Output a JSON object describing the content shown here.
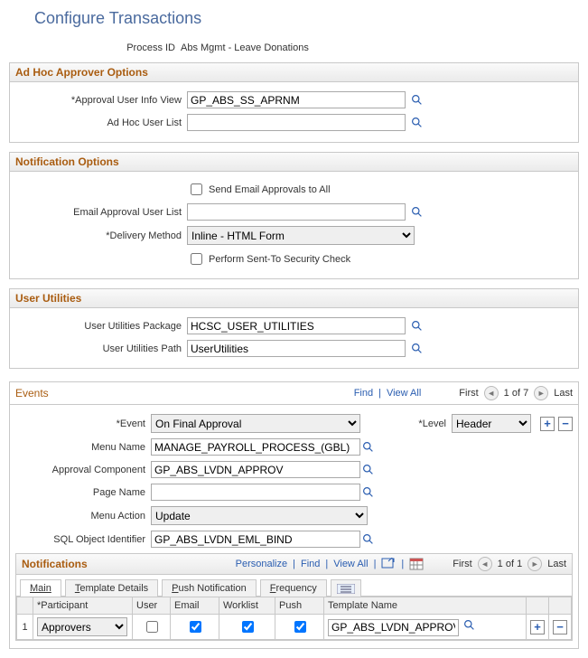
{
  "pageTitle": "Configure Transactions",
  "processId": {
    "label": "Process ID",
    "value": "Abs Mgmt - Leave Donations"
  },
  "adHoc": {
    "header": "Ad Hoc Approver Options",
    "approvalUserInfoView": {
      "label": "*Approval User Info View",
      "value": "GP_ABS_SS_APRNM"
    },
    "adHocUserList": {
      "label": "Ad Hoc User List",
      "value": ""
    }
  },
  "notificationOptions": {
    "header": "Notification Options",
    "sendEmailAll": {
      "label": "Send Email Approvals to All",
      "checked": false
    },
    "emailUserList": {
      "label": "Email Approval User List",
      "value": ""
    },
    "deliveryMethod": {
      "label": "*Delivery Method",
      "value": "Inline - HTML Form"
    },
    "performSentTo": {
      "label": "Perform Sent-To Security Check",
      "checked": false
    }
  },
  "userUtilities": {
    "header": "User Utilities",
    "package": {
      "label": "User Utilities Package",
      "value": "HCSC_USER_UTILITIES"
    },
    "path": {
      "label": "User Utilities Path",
      "value": "UserUtilities"
    }
  },
  "events": {
    "title": "Events",
    "findLabel": "Find",
    "viewAllLabel": "View All",
    "firstLabel": "First",
    "lastLabel": "Last",
    "counter": "1 of 7",
    "event": {
      "label": "*Event",
      "value": "On Final Approval"
    },
    "level": {
      "label": "*Level",
      "value": "Header"
    },
    "menuName": {
      "label": "Menu Name",
      "value": "MANAGE_PAYROLL_PROCESS_(GBL)"
    },
    "approvalComponent": {
      "label": "Approval Component",
      "value": "GP_ABS_LVDN_APPROV"
    },
    "pageName": {
      "label": "Page Name",
      "value": ""
    },
    "menuAction": {
      "label": "Menu Action",
      "value": "Update"
    },
    "sqlObject": {
      "label": "SQL Object Identifier",
      "value": "GP_ABS_LVDN_EML_BIND"
    }
  },
  "notifications": {
    "title": "Notifications",
    "personalize": "Personalize",
    "find": "Find",
    "viewAll": "View All",
    "first": "First",
    "last": "Last",
    "counter": "1 of 1",
    "tabs": {
      "main": "Main",
      "templateDetails": "Template Details",
      "pushNotification": "Push Notification",
      "frequency": "Frequency"
    },
    "columns": {
      "rownum": "",
      "participant": "*Participant",
      "user": "User",
      "email": "Email",
      "worklist": "Worklist",
      "push": "Push",
      "templateName": "Template Name"
    },
    "rows": [
      {
        "n": "1",
        "participant": "Approvers",
        "user": false,
        "email": true,
        "worklist": true,
        "push": true,
        "templateName": "GP_ABS_LVDN_APPROVED"
      }
    ]
  }
}
